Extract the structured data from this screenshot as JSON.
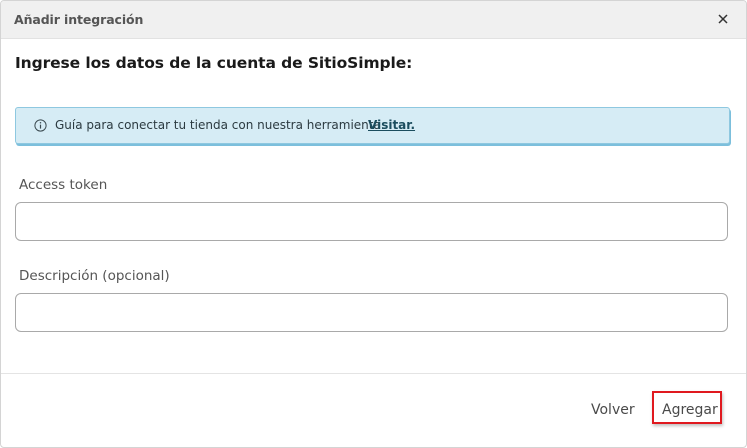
{
  "dialog": {
    "title": "Añadir integración",
    "close_icon": "close-icon"
  },
  "main": {
    "subtitle": "Ingrese los datos de la cuenta de SitioSimple:",
    "info_alert": {
      "icon": "info-icon",
      "text": "Guía para conectar tu tienda con nuestra herramienta.",
      "link_label": "Visitar.",
      "background_color": "#d6ecf5"
    },
    "fields": {
      "access_token": {
        "label": "Access token",
        "value": "",
        "placeholder": ""
      },
      "description": {
        "label": "Descripción (opcional)",
        "value": "",
        "placeholder": ""
      }
    }
  },
  "footer": {
    "back_label": "Volver",
    "add_label": "Agregar",
    "highlight_color": "#e0191f"
  }
}
